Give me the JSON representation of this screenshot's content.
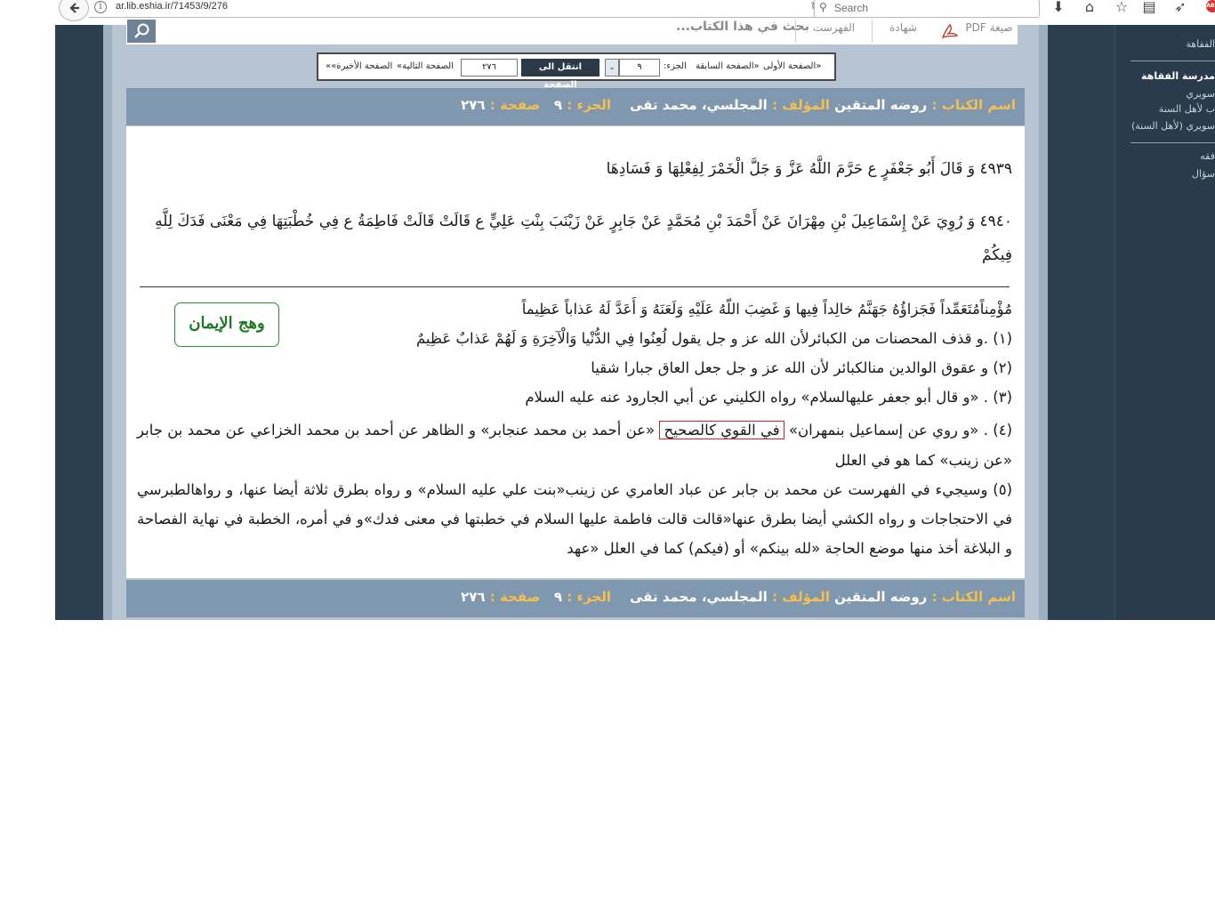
{
  "browser": {
    "url": "ar.lib.eshia.ir/71453/9/276",
    "search_placeholder": "Search"
  },
  "site_tabs": {
    "search_placeholder": "بحث في هذا الكتاب...",
    "fehrest": "الفهرست",
    "shahada": "شهادة",
    "pdf": "صيغة PDF"
  },
  "right_sidebar": {
    "items": [
      "الفقاهة",
      "مدرسة الفقاهة",
      "سويري",
      "ب لأهل السنة",
      "سويري (لأهل السنة)",
      "فقه",
      "سؤال"
    ]
  },
  "navigation": {
    "first_page": "«الصفحة الأولى",
    "prev_page": "«الصفحة السابقة",
    "volume_label": "الجزء:",
    "volume_value": "٩",
    "goto_button": "انتقل الی الصفحة",
    "page_value": "٢٧٦",
    "next_page": "الصفحة التالية»",
    "last_page": "الصفحة الأخيرة»»"
  },
  "book_info": {
    "book_name_label": "اسم الكتاب :",
    "book_name": "روضه المتقين",
    "author_label": "المؤلف :",
    "author": "المجلسي، محمد تقی",
    "volume_label": "الجزء :",
    "volume": "٩",
    "page_label": "صفحة :",
    "page": "٢٧٦"
  },
  "content": {
    "hadith_4939": "٤٩٣٩ وَ قَالَ أَبُو جَعْفَرٍ ع حَرَّمَ اللَّهُ عَزَّ وَ جَلَّ الْخَمْرَ لِفِعْلِهَا وَ فَسَادِهَا",
    "hadith_4940": "٤٩٤٠ وَ رُوِيَ عَنْ إِسْمَاعِيلَ بْنِ مِهْرَانَ عَنْ أَحْمَدَ بْنِ مُحَمَّدٍ عَنْ جَابِرٍ عَنْ زَيْنَبَ بِنْتِ عَلِيٍّ ع قَالَتْ قَالَتْ فَاطِمَةُ ع فِي خُطْبَتِهَا فِي مَعْنَى فَدَكَ لِلَّهِ فِيكُمْ",
    "verse_line": "مُؤْمِناًمُتَعَمِّداً فَجَزاؤُهُ جَهَنَّمُ خالِداً فِيها وَ غَضِبَ اللّهُ عَلَيْهِ وَلَعَنَهُ وَ أَعَدَّ لَهُ عَذاباً عَظِيماً",
    "footnote_1": "(١) .و قذف المحصنات من الكبائرلأن الله عز و جل يقول لُعِنُوا فِي الدُّنْيا وَالْآخِرَةِ وَ لَهُمْ عَذابٌ عَظِيمٌ",
    "footnote_2": "(٢) و عقوق الوالدين منالكبائر لأن الله عز و جل جعل العاق جبارا شقيا",
    "footnote_3": "(٣) . «و قال أبو جعفر عليهالسلام» رواه الكليني عن أبي الجارود عنه عليه السلام",
    "footnote_4_a": "(٤) . «و روي عن إسماعيل بنمهران»",
    "footnote_4_highlight": "في القوي كالصحيح",
    "footnote_4_b": "«عن أحمد بن محمد عنجابر» و الظاهر عن أحمد بن محمد الخزاعي عن محمد بن جابر «عن زينب» كما هو في العلل",
    "footnote_5": "(٥) وسيجيء في الفهرست عن محمد بن جابر عن عباد العامري عن زينب«بنت علي عليه السلام» و رواه بطرق ثلاثة أيضا عنها، و رواهالطبرسي في الاحتجاجات و رواه الكشي أيضا بطرق عنها«قالت قالت فاطمة عليها السلام في خطبتها في معنى فدك»و في أمره، الخطبة في نهاية الفصاحة و البلاغة أخذ منها موضع الحاجة «لله بينكم» أو (فيكم) كما في العلل «عهد",
    "logo_text": "وهج الإيمان"
  },
  "colors": {
    "frame": "#2c3f50",
    "info_bar": "#7f97af",
    "label_gold": "#f5c04d",
    "highlight_red": "#c62828",
    "logo_green": "#1e7a25"
  }
}
